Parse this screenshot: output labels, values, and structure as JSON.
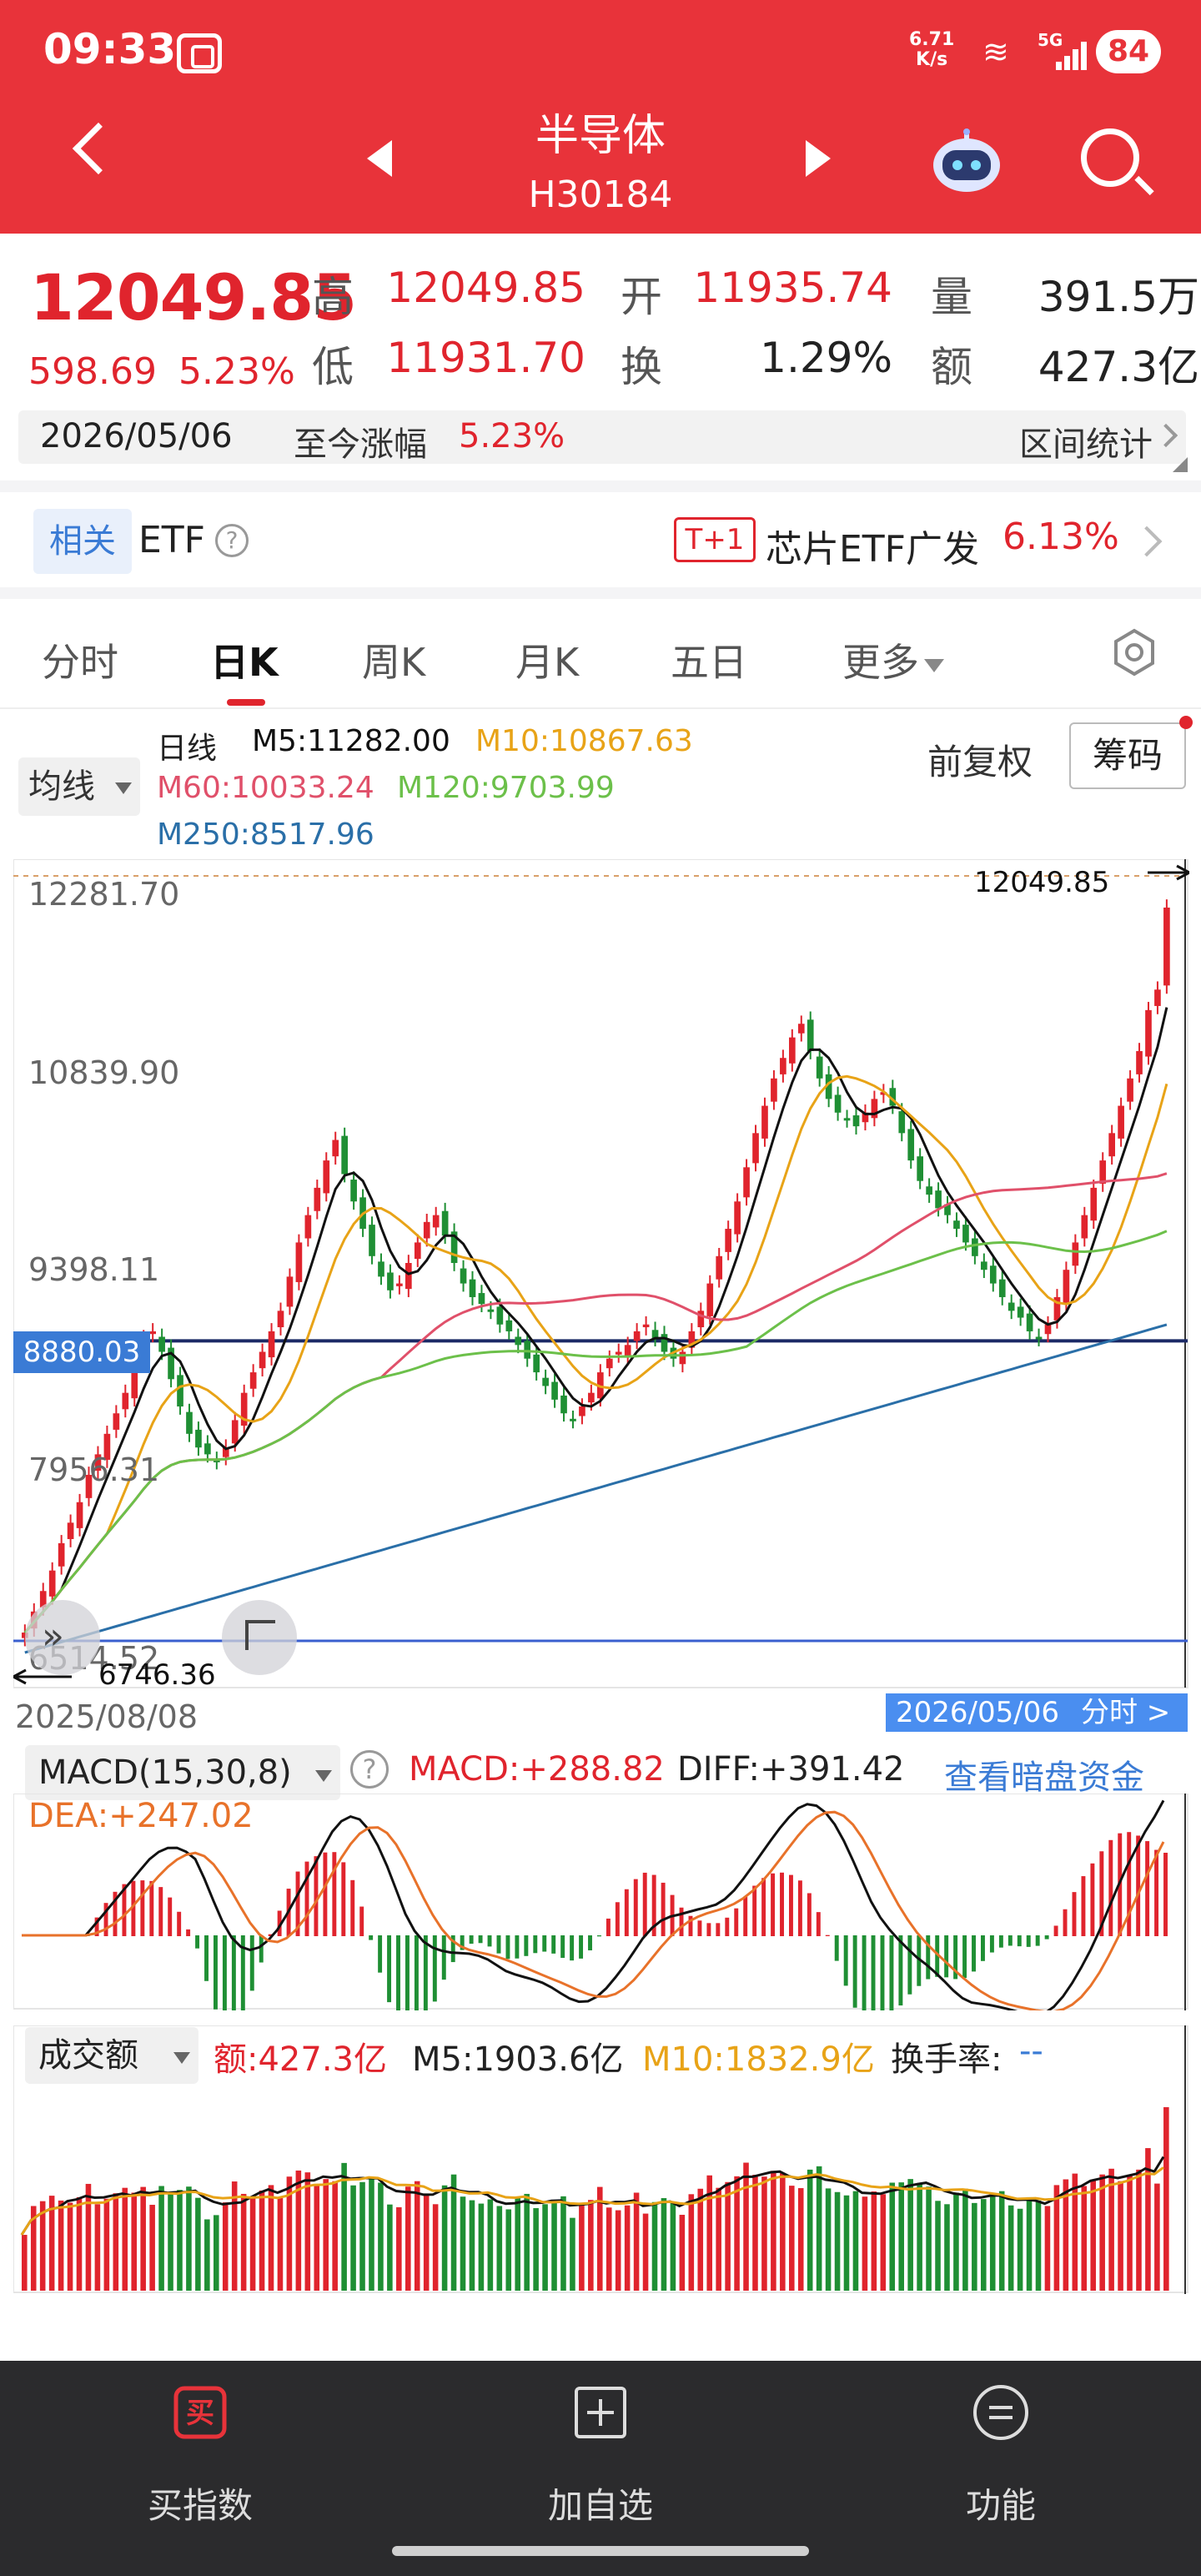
{
  "status_bar": {
    "time": "09:33",
    "net_speed_value": "6.71",
    "net_speed_unit": "K/s",
    "signal_label": "5G",
    "battery": "84"
  },
  "nav": {
    "title": "半导体",
    "code": "H30184"
  },
  "quote": {
    "price": "12049.85",
    "change": "598.69",
    "change_pct": "5.23%",
    "high_label": "高",
    "high": "12049.85",
    "open_label": "开",
    "open": "11935.74",
    "volume_label": "量",
    "volume": "391.5万",
    "low_label": "低",
    "low": "11931.70",
    "turnover_label": "换",
    "turnover": "1.29%",
    "amount_label": "额",
    "amount": "427.3亿"
  },
  "date_bar": {
    "date": "2026/05/06",
    "since_label": "至今涨幅",
    "since_value": "5.23%",
    "range_stats": "区间统计"
  },
  "etf": {
    "tag": "相关",
    "label": "ETF",
    "help": "?",
    "t1": "T+1",
    "name": "芯片ETF广发",
    "pct": "6.13%"
  },
  "tabs": [
    {
      "label": "分时",
      "active": false
    },
    {
      "label": "日K",
      "active": true
    },
    {
      "label": "周K",
      "active": false
    },
    {
      "label": "月K",
      "active": false
    },
    {
      "label": "五日",
      "active": false
    },
    {
      "label": "更多",
      "active": false
    }
  ],
  "ma_bar": {
    "select": "均线",
    "title": "日线",
    "m5": "M5:11282.00",
    "m10": "M10:10867.63",
    "m60": "M60:10033.24",
    "m120": "M120:9703.99",
    "m250": "M250:8517.96",
    "fq": "前复权",
    "chouma": "筹码"
  },
  "kchart": {
    "y_labels": [
      "12281.70",
      "10839.90",
      "9398.11",
      "7956.31",
      "6514.52"
    ],
    "last_price": "12049.85",
    "low_price": "6746.36",
    "crosshair_price": "8880.03",
    "start_date": "2025/08/08",
    "end_date": "2026/05/06",
    "end_tab": "分时 >"
  },
  "macd": {
    "select": "MACD(15,30,8)",
    "help": "?",
    "macd": "MACD:+288.82",
    "diff": "DIFF:+391.42",
    "link": "查看暗盘资金",
    "dea": "DEA:+247.02"
  },
  "volume_panel": {
    "select": "成交额",
    "amount": "额:427.3亿",
    "m5": "M5:1903.6亿",
    "m10": "M10:1832.9亿",
    "turnover_label": "换手率:",
    "turnover_value": "--"
  },
  "bottom_nav": [
    {
      "label": "买指数",
      "icon": "buy-icon"
    },
    {
      "label": "加自选",
      "icon": "add-watchlist-icon"
    },
    {
      "label": "功能",
      "icon": "menu-icon"
    }
  ],
  "colors": {
    "header": "#e8333a",
    "up": "#e0242d",
    "down": "#1f8f34",
    "m5": "#111111",
    "m10": "#e8a317",
    "m60": "#e0506a",
    "m120": "#6cc04a",
    "m250": "#2a6fa8",
    "accent": "#3a7bd5"
  },
  "chart_data": {
    "type": "candlestick",
    "title": "日线",
    "x_range": [
      "2025/08/08",
      "2026/05/06"
    ],
    "ylim": [
      6514.52,
      12281.7
    ],
    "y_ticks": [
      12281.7,
      10839.9,
      9398.11,
      7956.31,
      6514.52
    ],
    "close": [
      6746,
      6900,
      7050,
      7200,
      7400,
      7550,
      7700,
      7900,
      8050,
      8200,
      8350,
      8500,
      8700,
      8900,
      8950,
      8800,
      8600,
      8400,
      8200,
      8100,
      8050,
      8000,
      8100,
      8300,
      8500,
      8650,
      8800,
      8950,
      9100,
      9350,
      9600,
      9800,
      10000,
      10200,
      10350,
      10100,
      9900,
      9700,
      9500,
      9350,
      9250,
      9300,
      9450,
      9600,
      9750,
      9800,
      9650,
      9450,
      9300,
      9200,
      9150,
      9100,
      9000,
      8950,
      8850,
      8750,
      8650,
      8550,
      8450,
      8350,
      8300,
      8400,
      8500,
      8650,
      8750,
      8800,
      8850,
      8950,
      9000,
      8900,
      8800,
      8750,
      8800,
      8950,
      9100,
      9300,
      9500,
      9700,
      9900,
      10150,
      10400,
      10600,
      10800,
      10950,
      11100,
      11200,
      11000,
      10800,
      10650,
      10550,
      10500,
      10450,
      10550,
      10650,
      10700,
      10600,
      10400,
      10200,
      10050,
      9950,
      9850,
      9800,
      9700,
      9600,
      9500,
      9400,
      9300,
      9200,
      9100,
      9050,
      8950,
      8900,
      9000,
      9200,
      9400,
      9600,
      9800,
      10000,
      10200,
      10400,
      10600,
      10800,
      11000,
      11300,
      11450,
      12050
    ],
    "m5": 11282.0,
    "m10": 10867.63,
    "m60": 10033.24,
    "m120": 9703.99,
    "m250": 8517.96,
    "last": 12049.85,
    "high_marker": 12049.85,
    "low_marker": 6746.36,
    "crosshair": 8880.03,
    "macd_value": 288.82,
    "diff": 391.42,
    "dea": 247.02,
    "amount": 427.3,
    "amount_m5": 1903.6,
    "amount_m10": 1832.9
  }
}
